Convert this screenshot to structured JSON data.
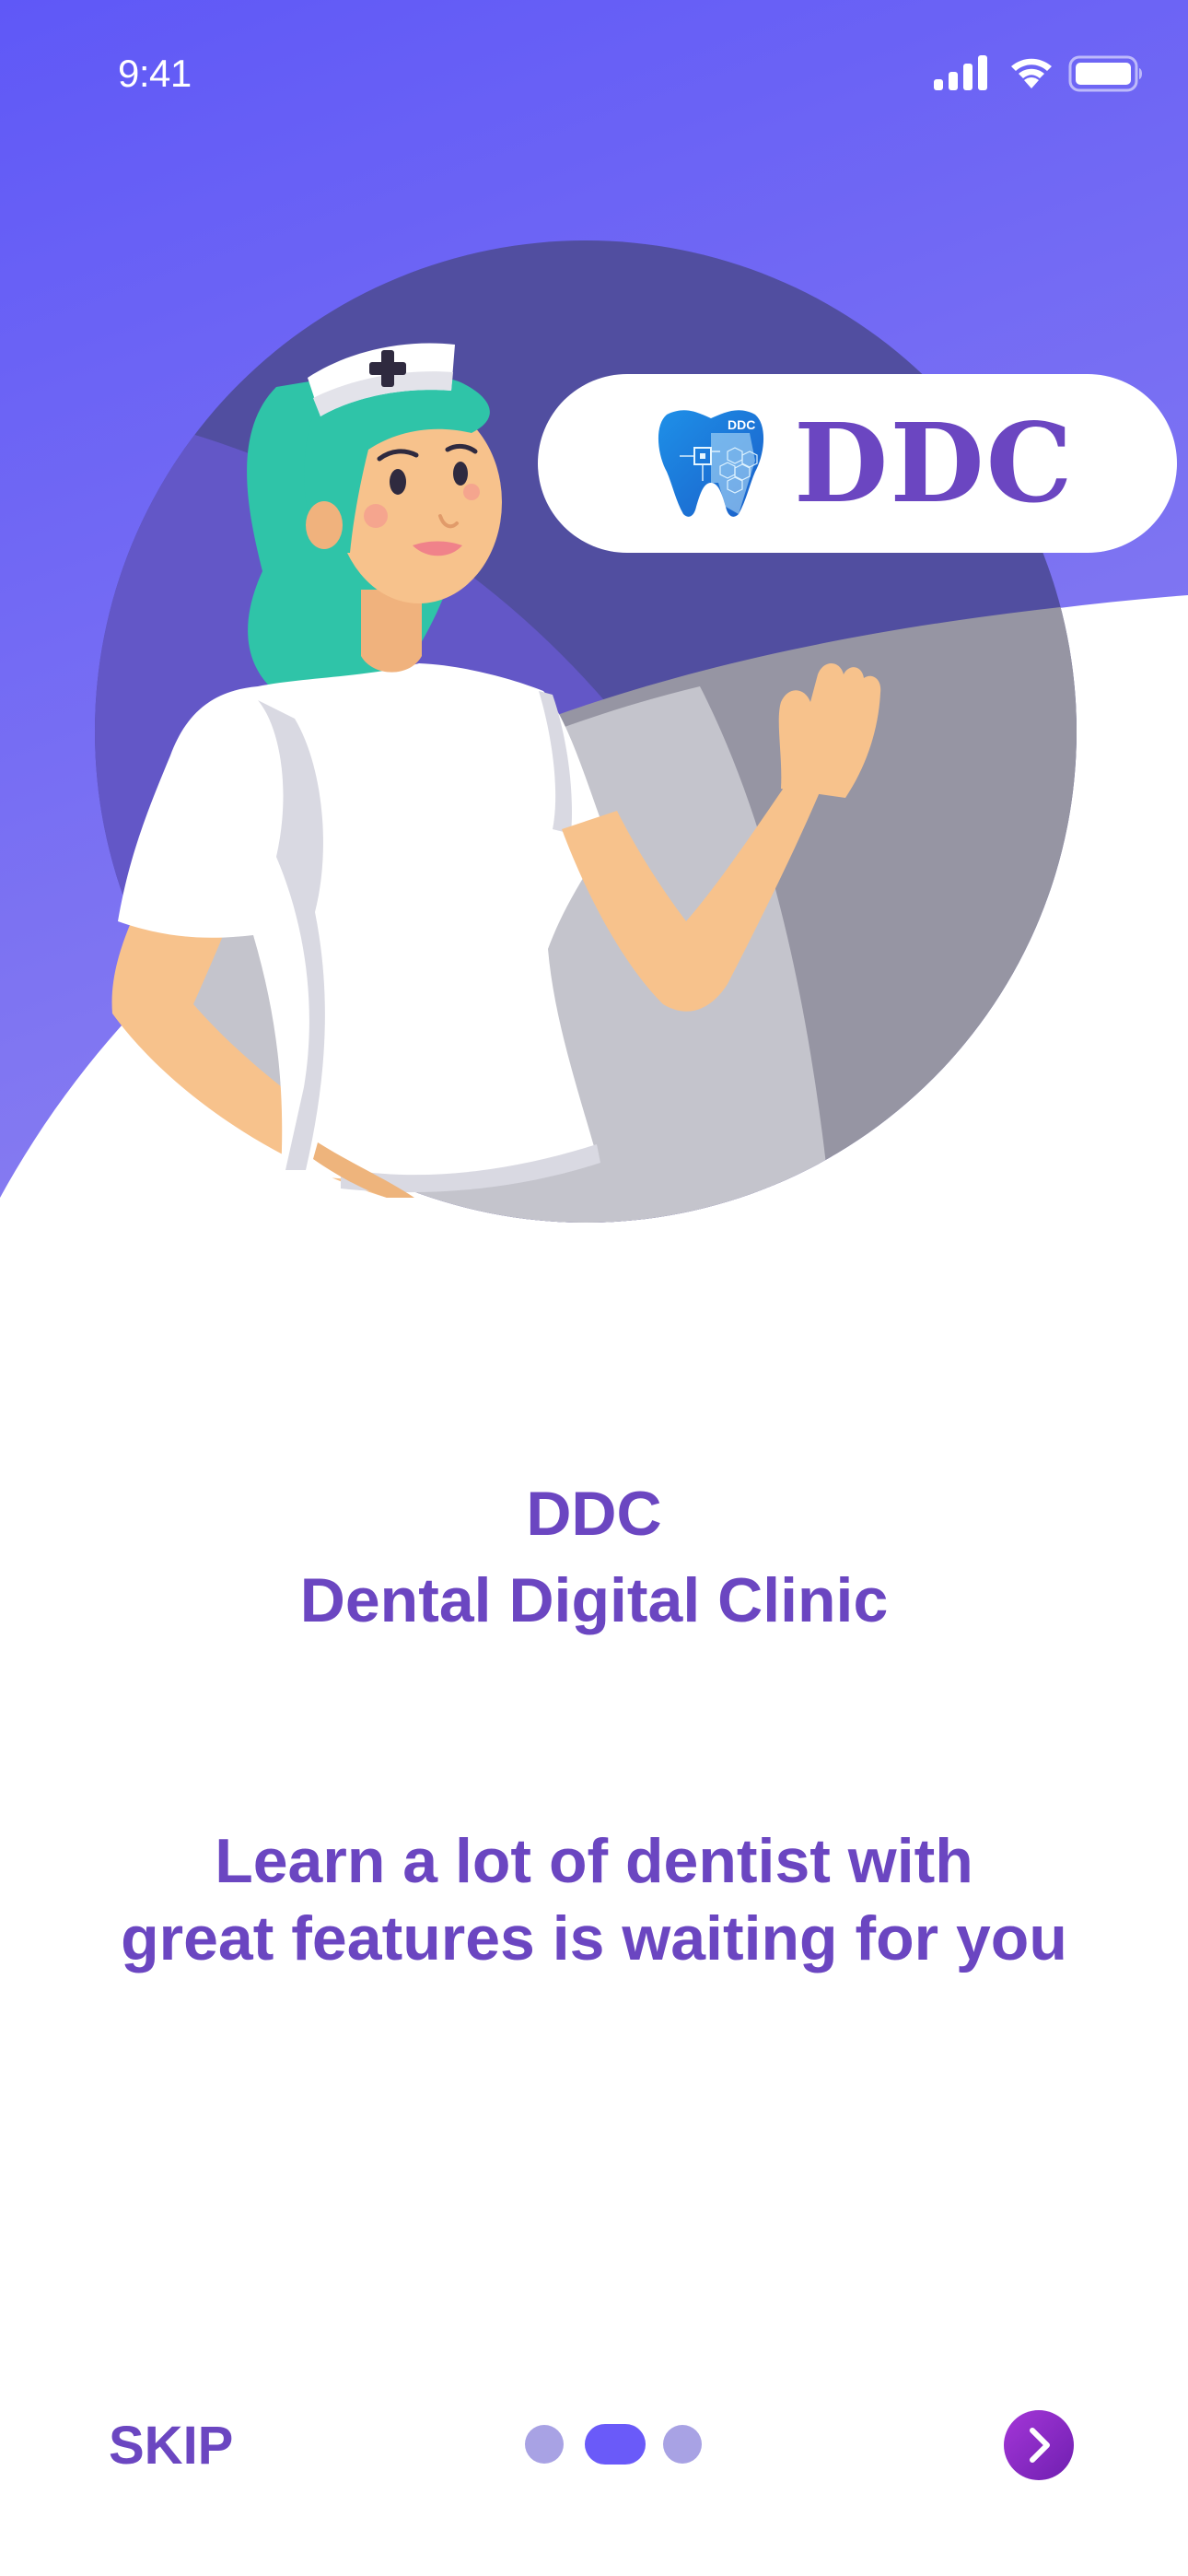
{
  "status_bar": {
    "time": "9:41",
    "icons": [
      "signal-icon",
      "wifi-icon",
      "battery-icon"
    ]
  },
  "logo": {
    "badge_text": "DDC",
    "wordmark": "DDC",
    "icon": "tooth-icon"
  },
  "onboarding": {
    "title": "DDC",
    "subtitle": "Dental Digital Clinic",
    "tagline_lines": [
      "Learn a lot of dentist with",
      "great features is waiting for you"
    ],
    "current_page": 2,
    "total_pages": 3
  },
  "controls": {
    "skip_label": "SKIP",
    "next_icon": "chevron-right-icon"
  },
  "colors": {
    "accent": "#6b46c1",
    "gradient_start": "#5f58f7",
    "gradient_end": "#8478ee",
    "dot_active": "#6a5af9",
    "dot_inactive": "#a8a2e4",
    "next_button": "#8e2bc9"
  }
}
